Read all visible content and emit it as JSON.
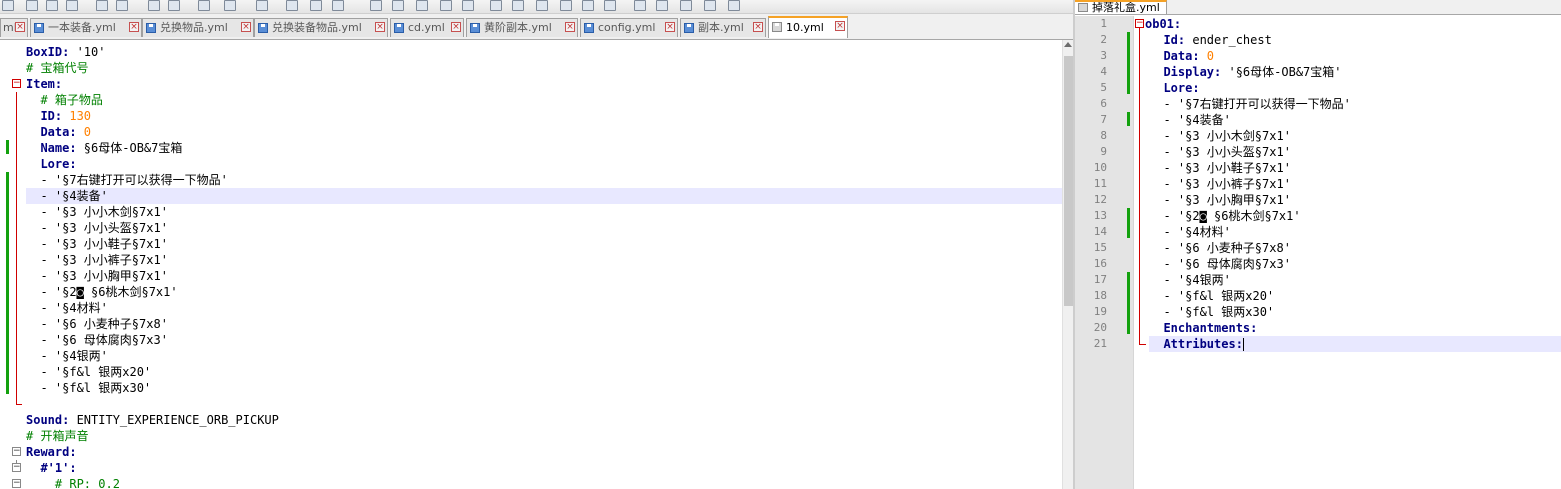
{
  "left_editor": {
    "tabs": [
      {
        "label": "ml"
      },
      {
        "label": "一本装备.yml"
      },
      {
        "label": "兑换物品.yml"
      },
      {
        "label": "兑换装备物品.yml"
      },
      {
        "label": "cd.yml"
      },
      {
        "label": "黄阶副本.yml"
      },
      {
        "label": "config.yml"
      },
      {
        "label": "副本.yml"
      },
      {
        "label": "10.yml",
        "active": true
      }
    ],
    "lines": [
      {
        "key": "BoxID:",
        "rest": " '10'"
      },
      {
        "comment": "# 宝箱代号"
      },
      {
        "key": "Item:"
      },
      {
        "comment": "  # 箱子物品"
      },
      {
        "key": "  ID:",
        "num": " 130"
      },
      {
        "key": "  Data:",
        "num": " 0"
      },
      {
        "key": "  Name:",
        "rest": " §6母体-OB&7宝箱"
      },
      {
        "key": "  Lore:"
      },
      {
        "text": "  - '§7右键打开可以获得一下物品'"
      },
      {
        "text": "  - '§4装备'"
      },
      {
        "text": "  - '§3 小小木剑§7x1'"
      },
      {
        "text": "  - '§3 小小头盔§7x1'"
      },
      {
        "text": "  - '§3 小小鞋子§7x1'"
      },
      {
        "text": "  - '§3 小小裤子§7x1'"
      },
      {
        "text": "  - '§3 小小胸甲§7x1'"
      },
      {
        "text": "  - '§2◙ §6桃木剑§7x1'"
      },
      {
        "text": "  - '§4材料'"
      },
      {
        "text": "  - '§6 小麦种子§7x8'"
      },
      {
        "text": "  - '§6 母体腐肉§7x3'"
      },
      {
        "text": "  - '§4银两'"
      },
      {
        "text": "  - '§f&l 银两x20'"
      },
      {
        "text": "  - '§f&l 银两x30'"
      },
      {
        "text": ""
      },
      {
        "key": "Sound:",
        "rest": " ENTITY_EXPERIENCE_ORB_PICKUP"
      },
      {
        "comment": "# 开箱声音"
      },
      {
        "key": "Reward:"
      },
      {
        "key": "  #'1':"
      },
      {
        "comment": "    # RP: 0.2"
      }
    ]
  },
  "right_editor": {
    "tab_label": "掉落礼盒.yml",
    "lines": [
      {
        "n": "1",
        "key": "ob01:"
      },
      {
        "n": "2",
        "key": "  Id:",
        "rest": " ender_chest"
      },
      {
        "n": "3",
        "key": "  Data:",
        "num": " 0"
      },
      {
        "n": "4",
        "key": "  Display:",
        "rest": " '§6母体-OB&7宝箱'"
      },
      {
        "n": "5",
        "key": "  Lore:"
      },
      {
        "n": "6",
        "text": "  - '§7右键打开可以获得一下物品'"
      },
      {
        "n": "7",
        "text": "  - '§4装备'"
      },
      {
        "n": "8",
        "text": "  - '§3 小小木剑§7x1'"
      },
      {
        "n": "9",
        "text": "  - '§3 小小头盔§7x1'"
      },
      {
        "n": "10",
        "text": "  - '§3 小小鞋子§7x1'"
      },
      {
        "n": "11",
        "text": "  - '§3 小小裤子§7x1'"
      },
      {
        "n": "12",
        "text": "  - '§3 小小胸甲§7x1'"
      },
      {
        "n": "13",
        "text": "  - '§2◙ §6桃木剑§7x1'"
      },
      {
        "n": "14",
        "text": "  - '§4材料'"
      },
      {
        "n": "15",
        "text": "  - '§6 小麦种子§7x8'"
      },
      {
        "n": "16",
        "text": "  - '§6 母体腐肉§7x3'"
      },
      {
        "n": "17",
        "text": "  - '§4银两'"
      },
      {
        "n": "18",
        "text": "  - '§f&l 银两x20'"
      },
      {
        "n": "19",
        "text": "  - '§f&l 银两x30'"
      },
      {
        "n": "20",
        "key": "  Enchantments:"
      },
      {
        "n": "21",
        "key": "  Attributes:"
      }
    ]
  },
  "colors": {
    "keyword": "#000080",
    "number": "#ff8000",
    "comment": "#008000",
    "current_line": "#e8e8ff",
    "change_bar": "#13a10e",
    "fold_line": "#d00000"
  }
}
